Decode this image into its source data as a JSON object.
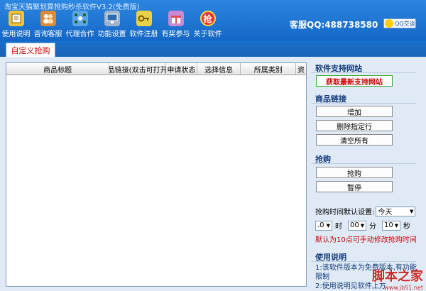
{
  "window": {
    "title": "淘宝天猫聚划算抢购秒杀软件V3.2(免费版)"
  },
  "toolbar": {
    "items": [
      {
        "label": "使用说明",
        "icon": "help-book-icon"
      },
      {
        "label": "咨询客服",
        "icon": "people-icon"
      },
      {
        "label": "代理合作",
        "icon": "network-icon"
      },
      {
        "label": "功能设置",
        "icon": "monitor-settings-icon"
      },
      {
        "label": "软件注册",
        "icon": "key-icon"
      },
      {
        "label": "有奖参与",
        "icon": "gift-icon"
      },
      {
        "label": "关于软件",
        "icon": "about-badge-icon",
        "glyph": "抢"
      }
    ],
    "support_qq": "客服QQ:488738580",
    "qq_badge": "QQ交谈"
  },
  "tabs": [
    {
      "label": "自定义抢购",
      "active": true
    }
  ],
  "grid": {
    "columns": [
      "商品标题",
      "品链接(双击可打开",
      "申请状态",
      "选择信息",
      "所属类别",
      "资"
    ],
    "rows": []
  },
  "side": {
    "supported_sites": {
      "title": "软件支持网站",
      "button": "获取最新支持网站"
    },
    "product_link": {
      "title": "商品链接",
      "buttons": [
        "增加",
        "删除指定行",
        "清空所有"
      ]
    },
    "purchase": {
      "title": "抢购",
      "buttons": [
        "抢购",
        "暂停"
      ]
    },
    "time_setting": {
      "label": "抢购时间默认设置:",
      "day_value": "今天",
      "hour_value": ".0",
      "hour_unit": "时",
      "minute_value": "00",
      "minute_unit": "分",
      "second_value": "10",
      "second_unit": "秒",
      "hint": "默认为10点可手动修改抢购时间"
    },
    "usage": {
      "title": "使用说明",
      "lines": [
        "1:该软件版本为免费版本,有功能限制",
        "2:使用说明见软件上方"
      ]
    }
  },
  "watermark": {
    "main": "脚本之家",
    "sub": "www.jb51.net"
  },
  "colors": {
    "toolbar_blue": "#1467c6",
    "accent_red": "#cc0000",
    "section_blue": "#133a7a"
  }
}
